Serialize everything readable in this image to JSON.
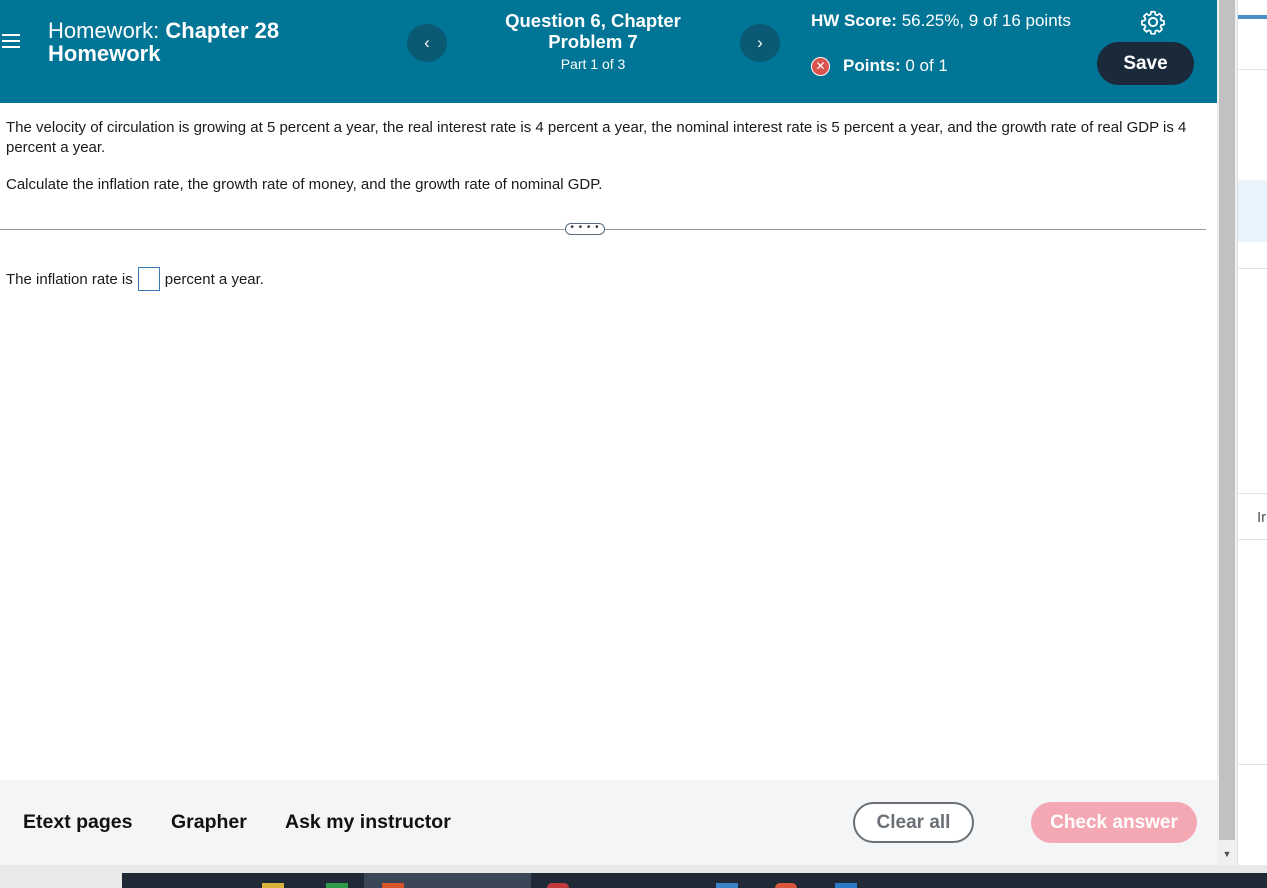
{
  "header": {
    "hw_prefix": "Homework:",
    "hw_name": "Chapter 28 Homework",
    "question_title": "Question 6, Chapter Problem 7",
    "part": "Part 1 of 3",
    "prev_glyph": "‹",
    "next_glyph": "›",
    "hw_score_label": "HW Score:",
    "hw_score_value": "56.25%, 9 of 16 points",
    "points_label": "Points:",
    "points_value": "0 of 1",
    "save_label": "Save"
  },
  "question": {
    "paragraph1": "The velocity of circulation is growing at 5 percent a year, the real interest rate is 4 percent a year, the nominal interest rate is 5 percent a year, and the growth rate of real GDP is 4 percent a year.",
    "paragraph2": "Calculate the inflation rate, the growth rate of money, and the growth rate of nominal GDP.",
    "expander_glyph": "• • • •",
    "answer_prefix": "The inflation rate is",
    "answer_suffix": "percent a year.",
    "answer_value": ""
  },
  "bottom": {
    "etext_label": "Etext pages",
    "grapher_label": "Grapher",
    "ask_label": "Ask my instructor",
    "clear_label": "Clear all",
    "check_label": "Check answer"
  },
  "side_panel": {
    "peek_text": "Ir"
  },
  "colors": {
    "header_bg": "#007596",
    "save_bg": "#1a2a3a",
    "check_bg": "#f4a8b3",
    "error_red": "#d9534f"
  },
  "icons": {
    "menu": "hamburger-icon",
    "settings": "gear-icon",
    "incorrect": "x-circle-icon"
  }
}
